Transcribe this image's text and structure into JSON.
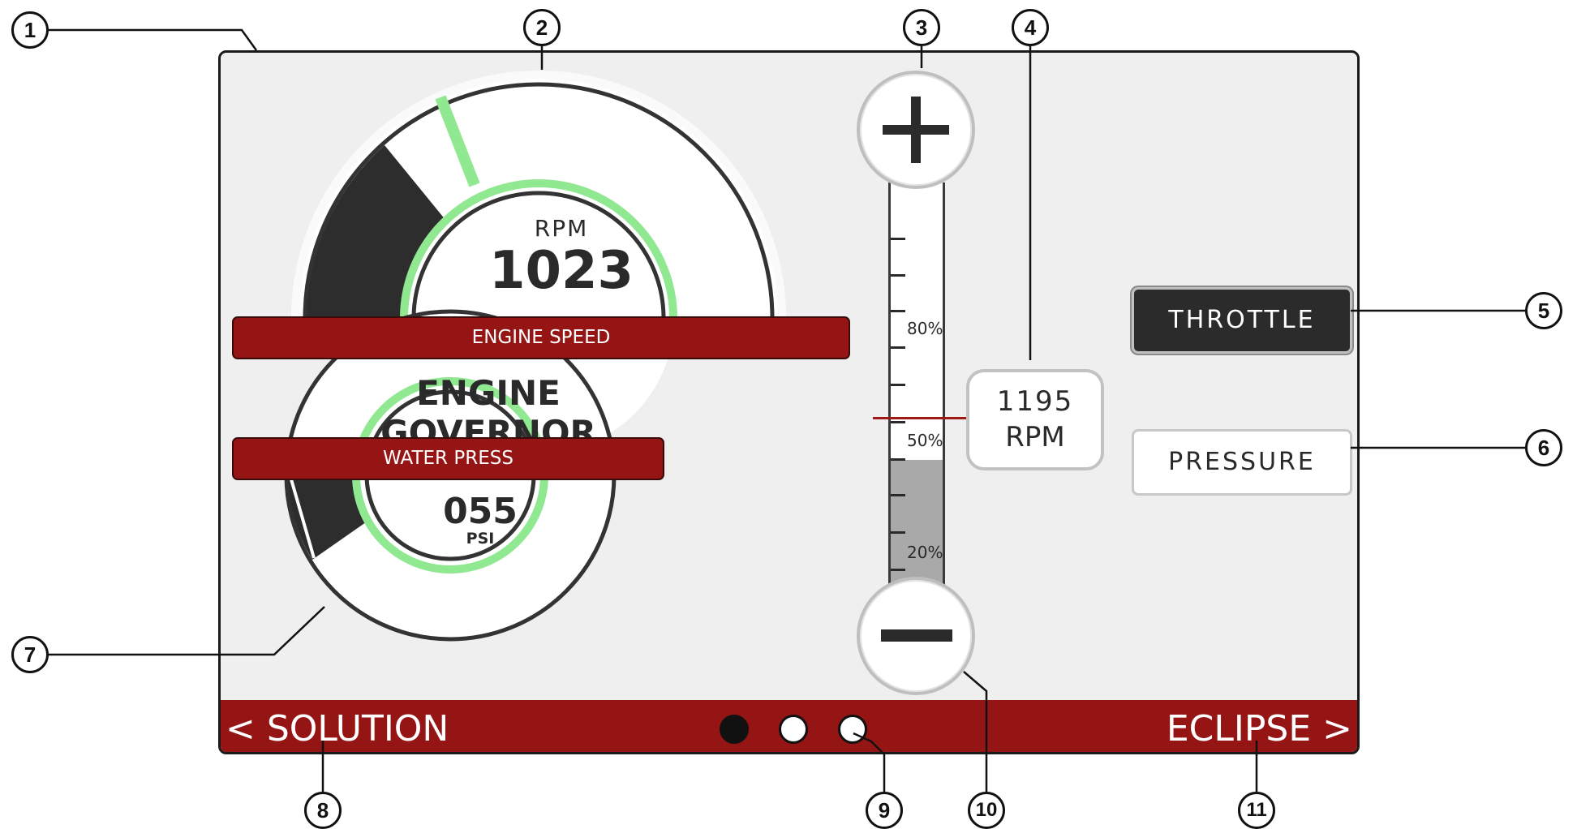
{
  "gauges": {
    "engine_speed": {
      "label": "RPM",
      "value": "1023",
      "strip": "ENGINE SPEED"
    },
    "water_press": {
      "value": "055",
      "unit": "PSI",
      "strip": "WATER PRESS"
    }
  },
  "title": "ENGINE GOVERNOR",
  "slider": {
    "ticks": [
      "80%",
      "50%",
      "20%"
    ],
    "fill_level_percent": 39,
    "setpoint": {
      "value": "1195",
      "unit": "RPM"
    }
  },
  "modes": {
    "throttle": "THROTTLE",
    "pressure": "PRESSURE",
    "active": "THROTTLE"
  },
  "nav": {
    "prev": "< SOLUTION",
    "next": "ECLIPSE >",
    "dots": [
      "active",
      "inactive",
      "inactive"
    ]
  },
  "callouts": [
    "1",
    "2",
    "3",
    "4",
    "5",
    "6",
    "7",
    "8",
    "9",
    "10",
    "11"
  ],
  "colors": {
    "brand_red": "#951414",
    "gauge_green": "#90e890",
    "panel_bg": "#efefef",
    "dark": "#2b2b2b"
  },
  "icons": {
    "increase": "plus-icon",
    "decrease": "minus-icon"
  }
}
